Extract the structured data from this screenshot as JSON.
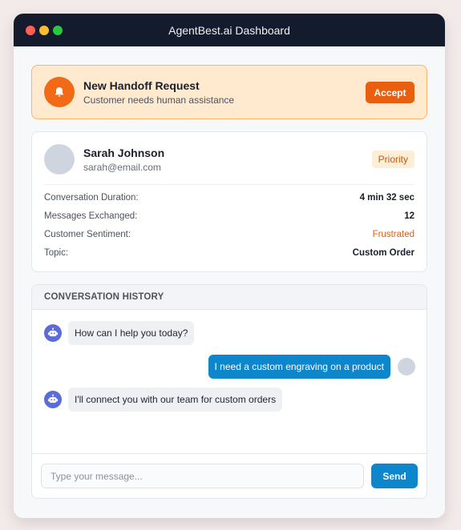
{
  "window": {
    "title": "AgentBest.ai Dashboard"
  },
  "handoff": {
    "icon": "bell-icon",
    "title": "New Handoff Request",
    "subtitle": "Customer needs human assistance",
    "accept_label": "Accept"
  },
  "customer": {
    "name": "Sarah Johnson",
    "email": "sarah@email.com",
    "badge": "Priority",
    "stats": [
      {
        "label": "Conversation Duration:",
        "value": "4 min 32 sec"
      },
      {
        "label": "Messages Exchanged:",
        "value": "12"
      },
      {
        "label": "Customer Sentiment:",
        "value": "Frustrated"
      },
      {
        "label": "Topic:",
        "value": "Custom Order"
      }
    ]
  },
  "conversation": {
    "header": "CONVERSATION HISTORY",
    "messages": [
      {
        "sender": "bot",
        "text": "How can I help you today?"
      },
      {
        "sender": "user",
        "text": "I need a custom engraving on a product"
      },
      {
        "sender": "bot",
        "text": "I'll connect you with our team for custom orders"
      }
    ],
    "input_placeholder": "Type your message...",
    "input_value": "",
    "send_label": "Send"
  },
  "colors": {
    "accent_orange": "#e8600f",
    "accent_blue": "#0e86cc",
    "sentiment_color": "#e0601a",
    "titlebar": "#141b2c"
  }
}
